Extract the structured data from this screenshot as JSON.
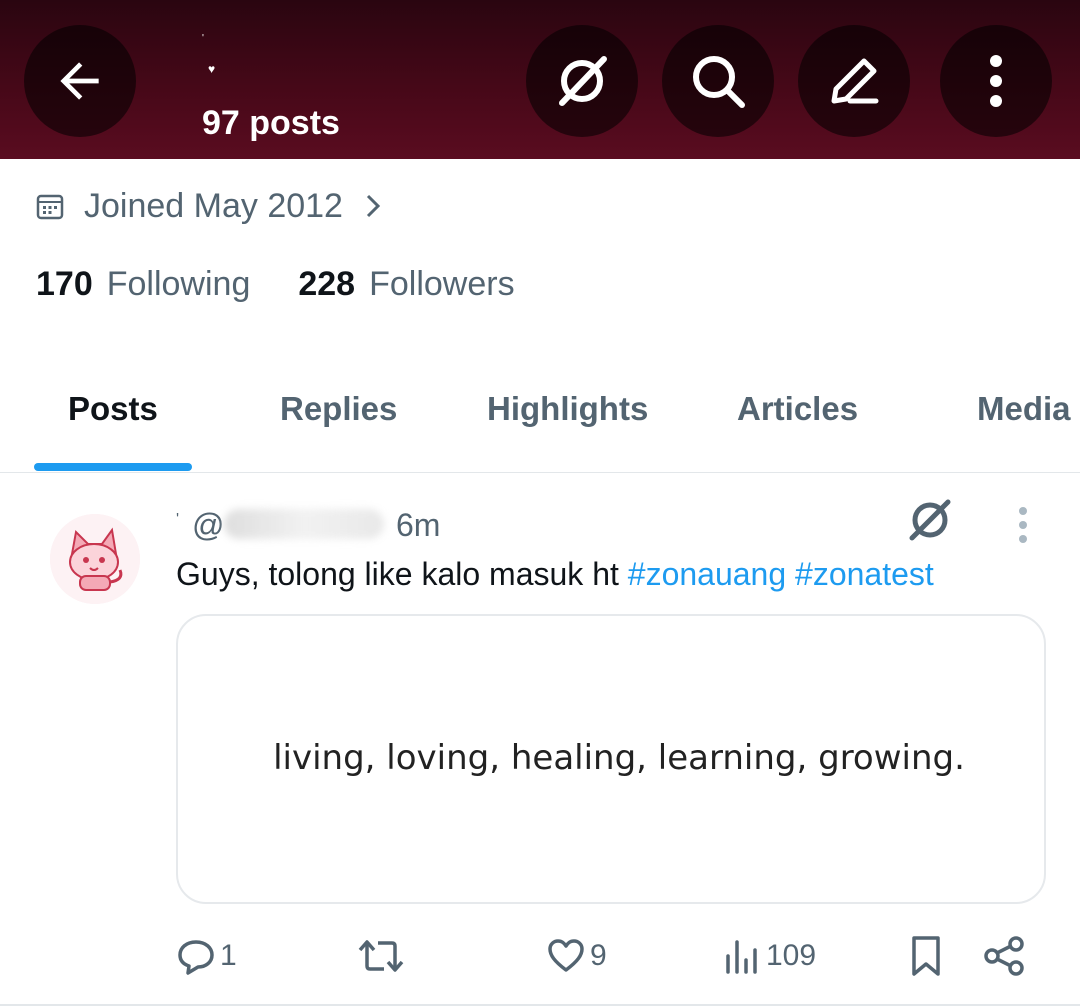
{
  "header": {
    "name_mark_top": "'",
    "name_mark_bottom": "♥",
    "posts_count": "97 posts",
    "icons": [
      "back-arrow-icon",
      "grok-icon",
      "search-icon",
      "compose-icon",
      "more-vertical-icon"
    ]
  },
  "profile": {
    "joined": "Joined May 2012",
    "following_count": "170",
    "following_label": "Following",
    "followers_count": "228",
    "followers_label": "Followers"
  },
  "tabs": [
    {
      "label": "Posts",
      "active": true
    },
    {
      "label": "Replies",
      "active": false
    },
    {
      "label": "Highlights",
      "active": false
    },
    {
      "label": "Articles",
      "active": false
    },
    {
      "label": "Media",
      "active": false
    }
  ],
  "post": {
    "name_mark": "'",
    "handle_prefix": "@",
    "time": "6m",
    "text": "Guys, tolong like kalo masuk ht ",
    "hashtags": [
      "#zonauang",
      "#zonatest"
    ],
    "media_text": "living, loving, healing, learning, growing.",
    "actions": {
      "replies": "1",
      "reposts": "",
      "likes": "9",
      "views": "109"
    }
  },
  "colors": {
    "header_bg": "#460818",
    "accent": "#1d9bf0",
    "secondary_text": "#536471"
  }
}
